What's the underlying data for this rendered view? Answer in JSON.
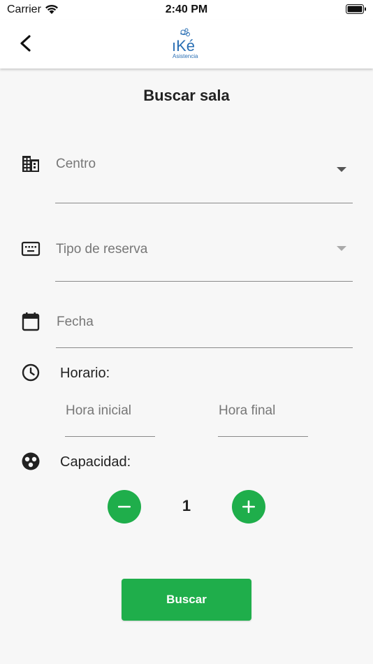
{
  "status_bar": {
    "carrier": "Carrier",
    "time": "2:40 PM"
  },
  "header": {
    "back_icon": "chevron-left-icon",
    "logo_text": "iKé",
    "logo_subtext": "Asistencia"
  },
  "page": {
    "title": "Buscar sala"
  },
  "form": {
    "centro": {
      "placeholder": "Centro",
      "icon": "building-icon"
    },
    "tipo_reserva": {
      "placeholder": "Tipo de reserva",
      "icon": "keyboard-icon"
    },
    "fecha": {
      "placeholder": "Fecha",
      "icon": "calendar-icon"
    },
    "horario": {
      "label": "Horario:",
      "icon": "clock-icon",
      "hora_inicial": "Hora inicial",
      "hora_final": "Hora final"
    },
    "capacidad": {
      "label": "Capacidad:",
      "icon": "group-icon",
      "value": "1"
    }
  },
  "actions": {
    "search_label": "Buscar"
  },
  "colors": {
    "accent": "#1fae4b",
    "background": "#f7f7f7",
    "header": "#ffffff"
  }
}
